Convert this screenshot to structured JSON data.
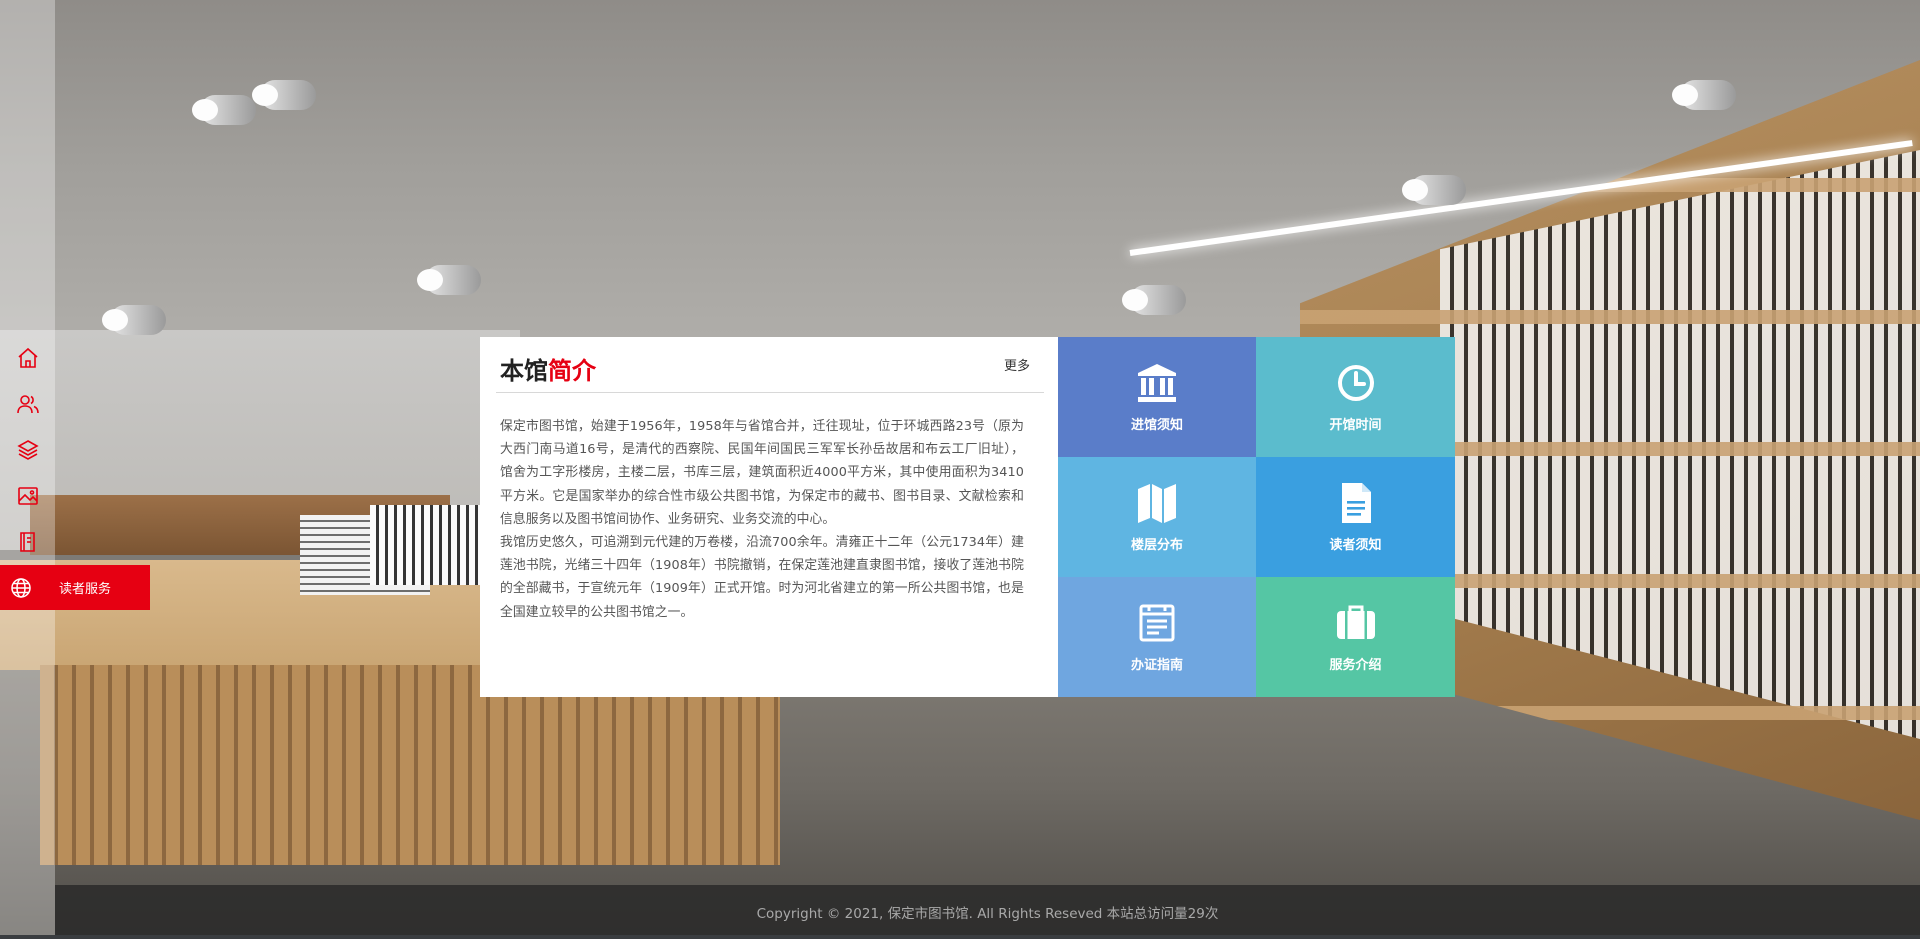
{
  "nav": {
    "items": [
      {
        "icon": "home-icon",
        "label": ""
      },
      {
        "icon": "users-icon",
        "label": ""
      },
      {
        "icon": "layers-icon",
        "label": ""
      },
      {
        "icon": "image-icon",
        "label": ""
      },
      {
        "icon": "book-icon",
        "label": ""
      },
      {
        "icon": "globe-icon",
        "label": "读者服务"
      }
    ],
    "active_color": "#e60012"
  },
  "intro": {
    "title_main": "本馆",
    "title_highlight": "简介",
    "more_label": "更多",
    "paragraph1": "保定市图书馆，始建于1956年，1958年与省馆合并，迁往现址，位于环城西路23号（原为大西门南马道16号，是清代的西察院、民国年间国民三军军长孙岳故居和布云工厂旧址），馆舍为工字形楼房，主楼二层，书库三层，建筑面积近4000平方米，其中使用面积为3410平方米。它是国家举办的综合性市级公共图书馆，为保定市的藏书、图书目录、文献检索和信息服务以及图书馆间协作、业务研究、业务交流的中心。",
    "paragraph2": "我馆历史悠久，可追溯到元代建的万卷楼，沿流700余年。清雍正十二年（公元1734年）建莲池书院，光绪三十四年（1908年）书院撤销，在保定莲池建直隶图书馆，接收了莲池书院的全部藏书，于宣统元年（1909年）正式开馆。时为河北省建立的第一所公共图书馆，也是全国建立较早的公共图书馆之一。"
  },
  "tiles": [
    {
      "label": "进馆须知",
      "icon": "building-icon",
      "color": "#5a7dc9"
    },
    {
      "label": "开馆时间",
      "icon": "clock-icon",
      "color": "#5bbccd"
    },
    {
      "label": "楼层分布",
      "icon": "map-icon",
      "color": "#5fb5e2"
    },
    {
      "label": "读者须知",
      "icon": "document-icon",
      "color": "#3a9fe0"
    },
    {
      "label": "办证指南",
      "icon": "card-icon",
      "color": "#6fa6e0"
    },
    {
      "label": "服务介绍",
      "icon": "briefcase-icon",
      "color": "#55c6a4"
    }
  ],
  "footer": {
    "text": "Copyright © 2021, 保定市图书馆. All Rights Reseved 本站总访问量29次"
  }
}
